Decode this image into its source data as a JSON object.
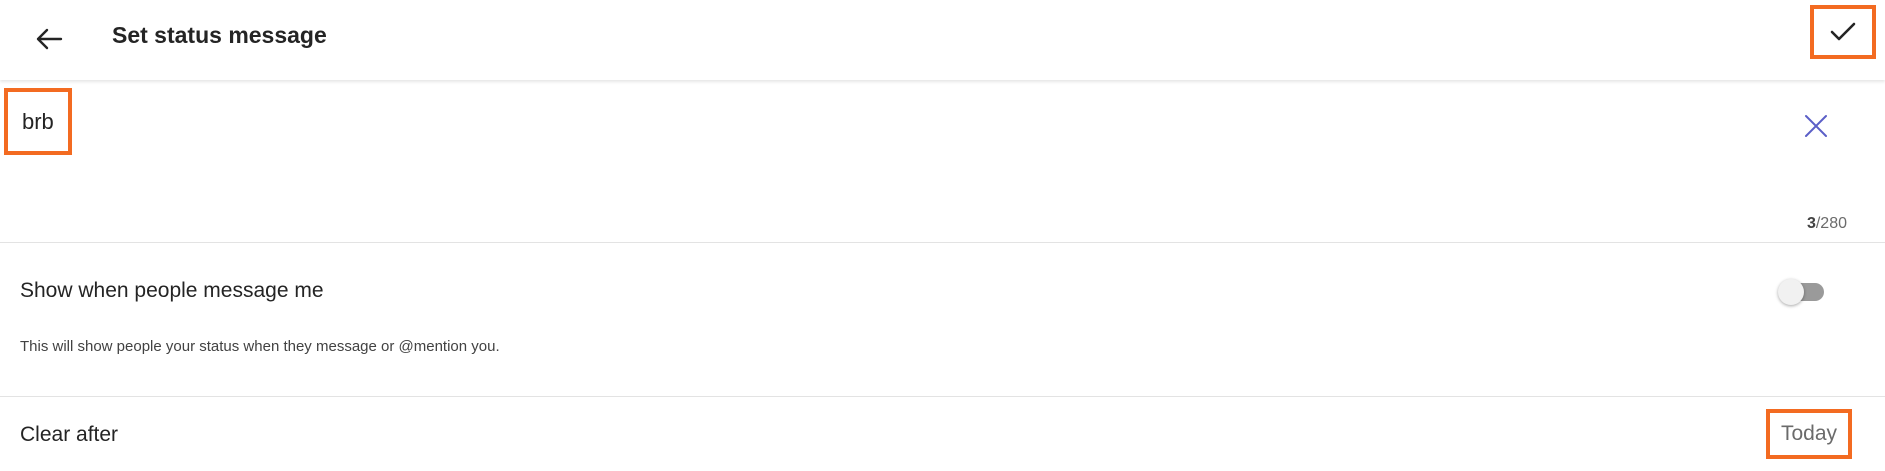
{
  "header": {
    "title": "Set status message",
    "back_icon": "arrow-left-icon",
    "confirm_icon": "checkmark-icon"
  },
  "message": {
    "value": "brb",
    "clear_icon": "close-icon",
    "char_count_current": "3",
    "char_count_max": "/280"
  },
  "show_when_messaged": {
    "label": "Show when people message me",
    "description": "This will show people your status when they message or @mention you.",
    "enabled": false
  },
  "clear_after": {
    "label": "Clear after",
    "value": "Today"
  },
  "colors": {
    "highlight": "#f36b21",
    "accent": "#5b5fc7",
    "text": "#242424",
    "muted": "#6b6b6b"
  }
}
